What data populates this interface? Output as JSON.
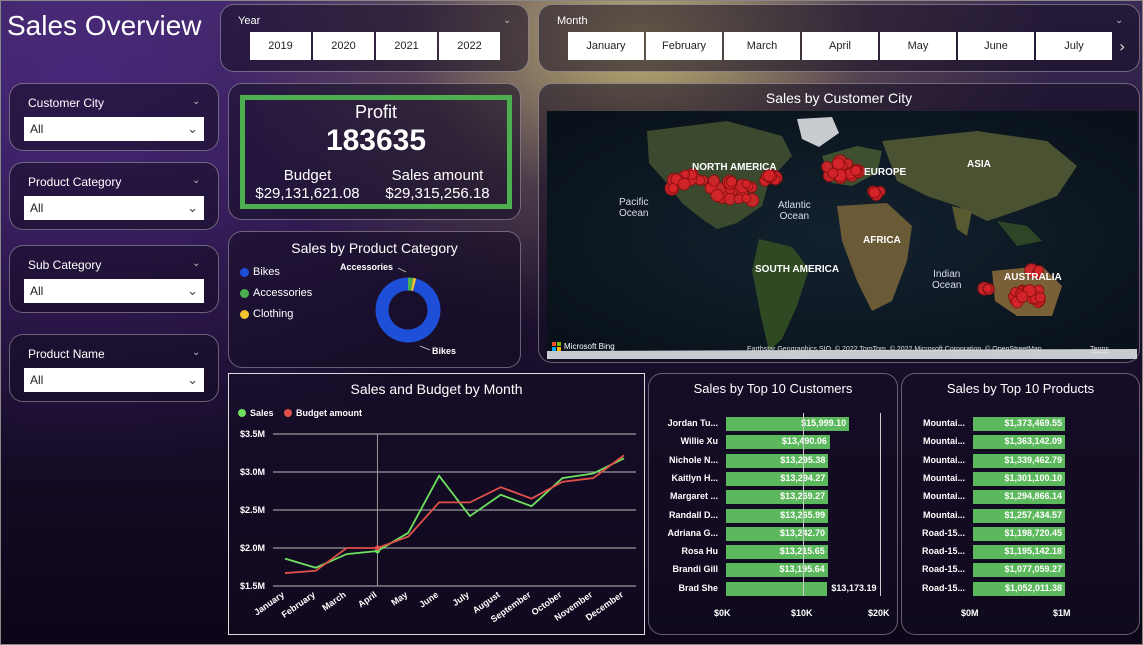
{
  "page": {
    "title": "Sales Overview"
  },
  "year_slicer": {
    "label": "Year",
    "options": [
      "2019",
      "2020",
      "2021",
      "2022"
    ]
  },
  "month_slicer": {
    "label": "Month",
    "options": [
      "January",
      "February",
      "March",
      "April",
      "May",
      "June",
      "July"
    ]
  },
  "filters": [
    {
      "label": "Customer City",
      "value": "All"
    },
    {
      "label": "Product Category",
      "value": "All"
    },
    {
      "label": "Sub Category",
      "value": "All"
    },
    {
      "label": "Product Name",
      "value": "All"
    }
  ],
  "kpi": {
    "profit_label": "Profit",
    "profit_value": "183635",
    "budget_label": "Budget",
    "budget_value": "$29,131,621.08",
    "sales_label": "Sales amount",
    "sales_value": "$29,315,256.18",
    "border_color": "#4caf50"
  },
  "category_chart": {
    "title": "Sales by Product Category",
    "legend": [
      {
        "name": "Bikes",
        "color": "#1e4fd8"
      },
      {
        "name": "Accessories",
        "color": "#4caf50"
      },
      {
        "name": "Clothing",
        "color": "#f2c230"
      }
    ],
    "annotations": {
      "top": "Accessories",
      "bottom": "Bikes"
    },
    "chart_data": {
      "type": "pie",
      "categories": [
        "Bikes",
        "Accessories",
        "Clothing"
      ],
      "values": [
        95.9,
        2.6,
        1.5
      ]
    }
  },
  "map": {
    "title": "Sales by Customer City",
    "labels": {
      "north_america": "NORTH AMERICA",
      "europe": "EUROPE",
      "asia": "ASIA",
      "africa": "AFRICA",
      "south_america": "SOUTH AMERICA",
      "australia": "AUSTRALIA",
      "pacific": "Pacific\nOcean",
      "atlantic": "Atlantic\nOcean",
      "indian": "Indian\nOcean"
    },
    "brand": "Microsoft Bing",
    "attribution": "Earthstar Geographics SIO, © 2022 TomTom, © 2022 Microsoft Corporation, © OpenStreetMap",
    "terms": "Terms"
  },
  "line_chart": {
    "title": "Sales and Budget by Month",
    "legend": [
      {
        "name": "Sales",
        "color": "#6ee060"
      },
      {
        "name": "Budget amount",
        "color": "#e0504a"
      }
    ],
    "chart_data": {
      "type": "line",
      "categories": [
        "January",
        "February",
        "March",
        "April",
        "May",
        "June",
        "July",
        "August",
        "September",
        "October",
        "November",
        "December"
      ],
      "series": [
        {
          "name": "Sales",
          "color": "#6ee060",
          "values": [
            1.86,
            1.74,
            1.92,
            1.96,
            2.2,
            2.95,
            2.42,
            2.7,
            2.55,
            2.92,
            2.98,
            3.18
          ]
        },
        {
          "name": "Budget amount",
          "color": "#e0504a",
          "values": [
            1.67,
            1.7,
            2.0,
            2.0,
            2.15,
            2.6,
            2.6,
            2.8,
            2.65,
            2.87,
            2.92,
            3.22
          ]
        }
      ],
      "ylim": [
        1.5,
        3.5
      ],
      "yticks": [
        "$3.5M",
        "$3.0M",
        "$2.5M",
        "$2.0M",
        "$1.5M"
      ],
      "ytick_values": [
        3.5,
        3.0,
        2.5,
        2.0,
        1.5
      ]
    }
  },
  "customers_chart": {
    "title": "Sales by Top 10 Customers",
    "chart_data": {
      "type": "bar",
      "categories": [
        "Jordan Tu...",
        "Willie Xu",
        "Nichole N...",
        "Kaitlyn H...",
        "Margaret ...",
        "Randall D...",
        "Adriana G...",
        "Rosa Hu",
        "Brandi Gill",
        "Brad She"
      ],
      "values": [
        15999.1,
        13490.06,
        13295.38,
        13294.27,
        13269.27,
        13265.99,
        13242.7,
        13215.65,
        13195.64,
        13173.19
      ],
      "value_labels": [
        "$15,999.10",
        "$13,490.06",
        "$13,295.38",
        "$13,294.27",
        "$13,269.27",
        "$13,265.99",
        "$13,242.70",
        "$13,215.65",
        "$13,195.64",
        "$13,173.19"
      ],
      "xlim": [
        0,
        20000
      ],
      "xticks": [
        "$0K",
        "$10K",
        "$20K"
      ]
    }
  },
  "products_chart": {
    "title": "Sales by Top 10 Products",
    "chart_data": {
      "type": "bar",
      "categories": [
        "Mountai...",
        "Mountai...",
        "Mountai...",
        "Mountai...",
        "Mountai...",
        "Mountai...",
        "Road-15...",
        "Road-15...",
        "Road-15...",
        "Road-15..."
      ],
      "values": [
        1373469.55,
        1363142.09,
        1339462.79,
        1301100.1,
        1294866.14,
        1257434.57,
        1198720.45,
        1195142.18,
        1077059.27,
        1052011.38
      ],
      "value_labels": [
        "$1,373,469.55",
        "$1,363,142.09",
        "$1,339,462.79",
        "$1,301,100.10",
        "$1,294,866.14",
        "$1,257,434.57",
        "$1,198,720.45",
        "$1,195,142.18",
        "$1,077,059.27",
        "$1,052,011.38"
      ],
      "xlim": [
        0,
        1000000
      ],
      "xticks": [
        "$0M",
        "$1M"
      ]
    }
  }
}
